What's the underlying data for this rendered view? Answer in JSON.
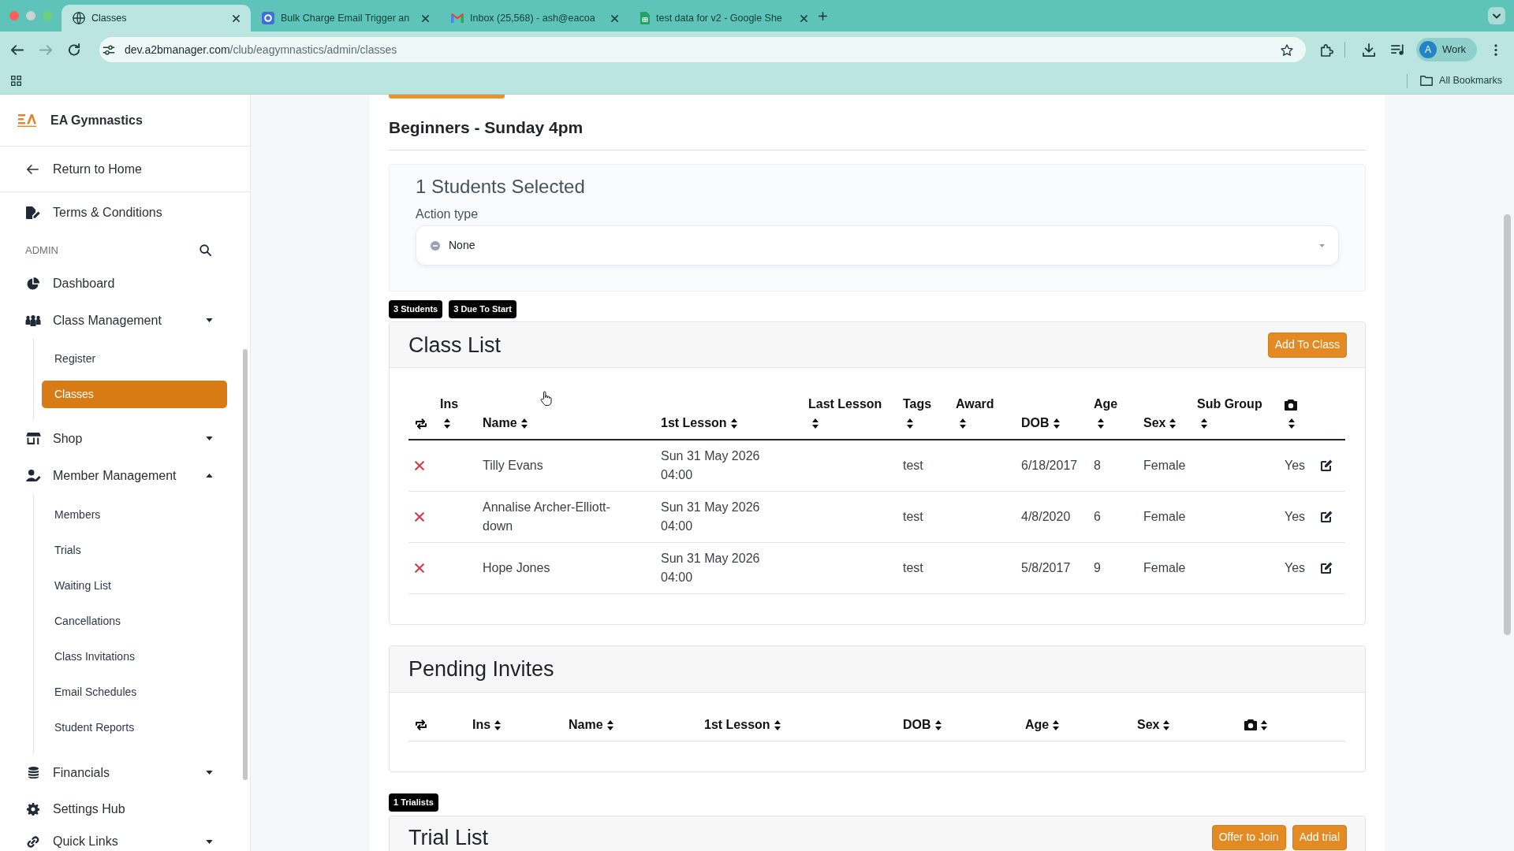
{
  "browser": {
    "tabs": [
      {
        "title": "Classes",
        "selected": true
      },
      {
        "title": "Bulk Charge Email Trigger an",
        "selected": false
      },
      {
        "title": "Inbox (25,568) - ash@eacoa",
        "selected": false
      },
      {
        "title": "test data for v2 - Google She",
        "selected": false
      }
    ],
    "address": {
      "host": "dev.a2bmanager.com",
      "path": "/club/eagymnastics/admin/classes"
    },
    "profile": {
      "avatar": "A",
      "label": "Work"
    },
    "bookmarks_label": "All Bookmarks"
  },
  "sidebar": {
    "brand": "EA Gymnastics",
    "back_link": "Return to Home",
    "items": [
      {
        "kind": "link",
        "label": "Terms & Conditions",
        "selected": false
      },
      {
        "kind": "section",
        "label": "ADMIN"
      },
      {
        "kind": "link",
        "label": "Dashboard",
        "selected": false
      },
      {
        "kind": "group",
        "label": "Class Management",
        "selected": false,
        "expanded": false,
        "children": [
          {
            "label": "Register",
            "selected": false
          },
          {
            "label": "Classes",
            "selected": true
          }
        ]
      },
      {
        "kind": "group",
        "label": "Shop",
        "selected": false,
        "expanded": false
      },
      {
        "kind": "group",
        "label": "Member Management",
        "selected": false,
        "expanded": true,
        "children": [
          {
            "label": "Members",
            "selected": false
          },
          {
            "label": "Trials",
            "selected": false
          },
          {
            "label": "Waiting List",
            "selected": false
          },
          {
            "label": "Cancellations",
            "selected": false
          },
          {
            "label": "Class Invitations",
            "selected": false
          },
          {
            "label": "Email Schedules",
            "selected": false
          },
          {
            "label": "Student Reports",
            "selected": false
          }
        ]
      },
      {
        "kind": "group",
        "label": "Financials",
        "selected": false,
        "expanded": false
      },
      {
        "kind": "link",
        "label": "Settings Hub",
        "selected": false
      },
      {
        "kind": "group",
        "label": "Quick Links",
        "selected": false,
        "expanded": false
      }
    ]
  },
  "page": {
    "class_title": "Beginners - Sunday 4pm",
    "selection": {
      "title": "1 Students Selected",
      "field_label": "Action type",
      "value": "None"
    },
    "class_badges": [
      "3 Students",
      "3 Due To Start"
    ],
    "class_list": {
      "title": "Class List",
      "buttons": [
        "Add To Class"
      ],
      "columns": [
        {
          "kind": "icon",
          "sortable": false
        },
        {
          "kind": "text",
          "label": "Ins",
          "sortable": true
        },
        {
          "kind": "text",
          "label": "Name",
          "sortable": true
        },
        {
          "kind": "text",
          "label": "1st Lesson",
          "sortable": true
        },
        {
          "kind": "text",
          "label": "Last Lesson",
          "sortable": true
        },
        {
          "kind": "text",
          "label": "Tags",
          "sortable": true
        },
        {
          "kind": "text",
          "label": "Award",
          "sortable": true
        },
        {
          "kind": "text",
          "label": "DOB",
          "sortable": true
        },
        {
          "kind": "text",
          "label": "Age",
          "sortable": true
        },
        {
          "kind": "text",
          "label": "Sex",
          "sortable": true
        },
        {
          "kind": "text",
          "label": "Sub Group",
          "sortable": true
        },
        {
          "kind": "icon",
          "sortable": true
        }
      ],
      "rows": [
        {
          "name": "Tilly Evans",
          "first_lesson": "Sun 31 May 2026 04:00",
          "tags": "test",
          "dob": "6/18/2017",
          "age": "8",
          "sex": "Female",
          "photo": "Yes"
        },
        {
          "name": "Annalise Archer-Elliott-down",
          "first_lesson": "Sun 31 May 2026 04:00",
          "tags": "test",
          "dob": "4/8/2020",
          "age": "6",
          "sex": "Female",
          "photo": "Yes"
        },
        {
          "name": "Hope Jones",
          "first_lesson": "Sun 31 May 2026 04:00",
          "tags": "test",
          "dob": "5/8/2017",
          "age": "9",
          "sex": "Female",
          "photo": "Yes"
        }
      ]
    },
    "pending_invites": {
      "title": "Pending Invites",
      "columns": [
        {
          "kind": "icon",
          "sortable": false
        },
        {
          "kind": "text",
          "label": "Ins",
          "sortable": true
        },
        {
          "kind": "text",
          "label": "Name",
          "sortable": true
        },
        {
          "kind": "text",
          "label": "1st Lesson",
          "sortable": true
        },
        {
          "kind": "text",
          "label": "DOB",
          "sortable": true
        },
        {
          "kind": "text",
          "label": "Age",
          "sortable": true
        },
        {
          "kind": "text",
          "label": "Sex",
          "sortable": true
        },
        {
          "kind": "icon",
          "sortable": true
        }
      ]
    },
    "trial_badges": [
      "1 Trialists"
    ],
    "trial_list": {
      "title": "Trial List",
      "buttons": [
        "Offer to Join",
        "Add trial"
      ]
    }
  }
}
